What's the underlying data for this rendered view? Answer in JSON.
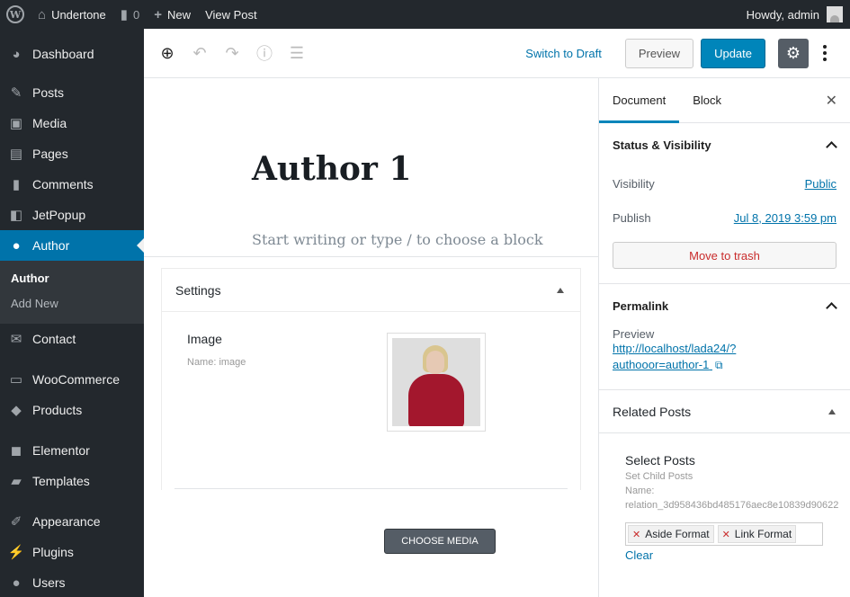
{
  "adminbar": {
    "site_name": "Undertone",
    "comments_count": "0",
    "new_label": "New",
    "view_post": "View Post",
    "howdy": "Howdy, admin"
  },
  "sidebar": {
    "items": [
      {
        "label": "Dashboard",
        "icon": "dashboard-icon"
      },
      {
        "label": "Posts",
        "icon": "pin-icon"
      },
      {
        "label": "Media",
        "icon": "media-icon"
      },
      {
        "label": "Pages",
        "icon": "pages-icon"
      },
      {
        "label": "Comments",
        "icon": "comment-icon"
      },
      {
        "label": "JetPopup",
        "icon": "popup-icon"
      },
      {
        "label": "Author",
        "icon": "user-icon"
      },
      {
        "label": "Contact",
        "icon": "mail-icon"
      },
      {
        "label": "WooCommerce",
        "icon": "woo-icon"
      },
      {
        "label": "Products",
        "icon": "box-icon"
      },
      {
        "label": "Elementor",
        "icon": "elementor-icon"
      },
      {
        "label": "Templates",
        "icon": "folder-icon"
      },
      {
        "label": "Appearance",
        "icon": "brush-icon"
      },
      {
        "label": "Plugins",
        "icon": "plug-icon"
      },
      {
        "label": "Users",
        "icon": "user-icon"
      }
    ],
    "submenu": [
      "Author",
      "Add New"
    ]
  },
  "toolbar": {
    "switch_draft": "Switch to Draft",
    "preview": "Preview",
    "update": "Update"
  },
  "editor": {
    "title": "Author 1",
    "placeholder": "Start writing or type / to choose a block",
    "settings": {
      "header": "Settings",
      "field_label": "Image",
      "field_name": "Name: image",
      "choose_media": "CHOOSE MEDIA"
    }
  },
  "panel": {
    "tabs": [
      "Document",
      "Block"
    ],
    "status": {
      "title": "Status & Visibility",
      "visibility_label": "Visibility",
      "visibility_value": "Public",
      "publish_label": "Publish",
      "publish_value": "Jul 8, 2019 3:59 pm",
      "trash": "Move to trash"
    },
    "permalink": {
      "title": "Permalink",
      "preview_label": "Preview",
      "link_line1": "http://localhost/lada24/?",
      "link_line2": "authooor=author-1"
    },
    "related": {
      "title": "Related Posts",
      "field_title": "Select Posts",
      "field_sub1": "Set Child Posts",
      "field_sub2": "Name:",
      "field_sub3": "relation_3d958436bd485176aec8e10839d90622",
      "tags": [
        "Aside Format",
        "Link Format"
      ],
      "clear": "Clear"
    }
  },
  "colors": {
    "admin_bg": "#23282d",
    "accent": "#0073aa",
    "update_btn": "#0085ba",
    "danger": "#c92c2c"
  }
}
